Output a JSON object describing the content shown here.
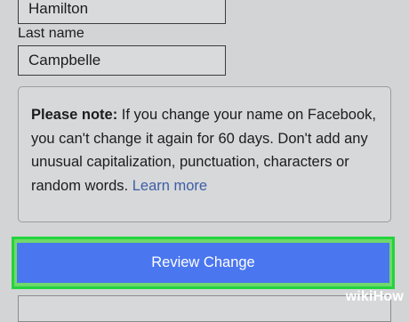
{
  "form": {
    "first_name_value": "Hamilton",
    "last_name_label": "Last name",
    "last_name_value": "Campbelle"
  },
  "note": {
    "bold_lead": "Please note:",
    "text": " If you change your name on Facebook, you can't change it again for 60 days. Don't add any unusual capitalization, punctuation, characters or random words. ",
    "link": "Learn more"
  },
  "buttons": {
    "review_change": "Review Change"
  },
  "watermark": {
    "wiki": "wiki",
    "how": "How"
  },
  "colors": {
    "button_blue": "#4a76f0",
    "highlight_green": "#24d33c",
    "link_blue": "#3d5ea4"
  }
}
